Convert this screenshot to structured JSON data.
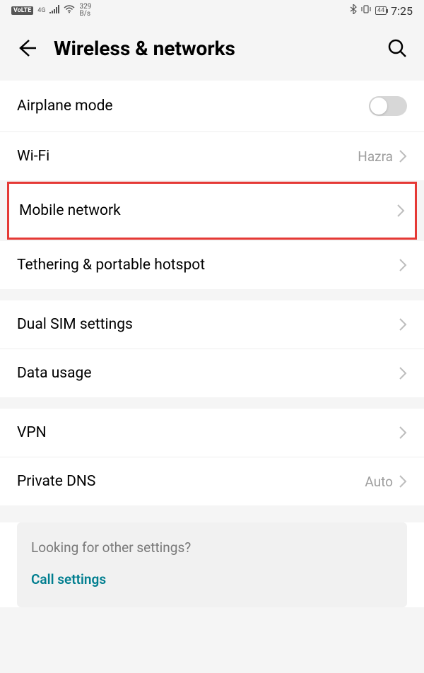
{
  "status": {
    "volte": "VoLTE",
    "net_gen": "4G",
    "speed_num": "329",
    "speed_unit": "B/s",
    "battery": "44",
    "time": "7:25"
  },
  "header": {
    "title": "Wireless & networks"
  },
  "rows": {
    "airplane": "Airplane mode",
    "wifi_label": "Wi-Fi",
    "wifi_value": "Hazra",
    "mobile": "Mobile network",
    "tethering": "Tethering & portable hotspot",
    "dual_sim": "Dual SIM settings",
    "data_usage": "Data usage",
    "vpn": "VPN",
    "private_dns_label": "Private DNS",
    "private_dns_value": "Auto"
  },
  "footer": {
    "question": "Looking for other settings?",
    "link": "Call settings"
  }
}
